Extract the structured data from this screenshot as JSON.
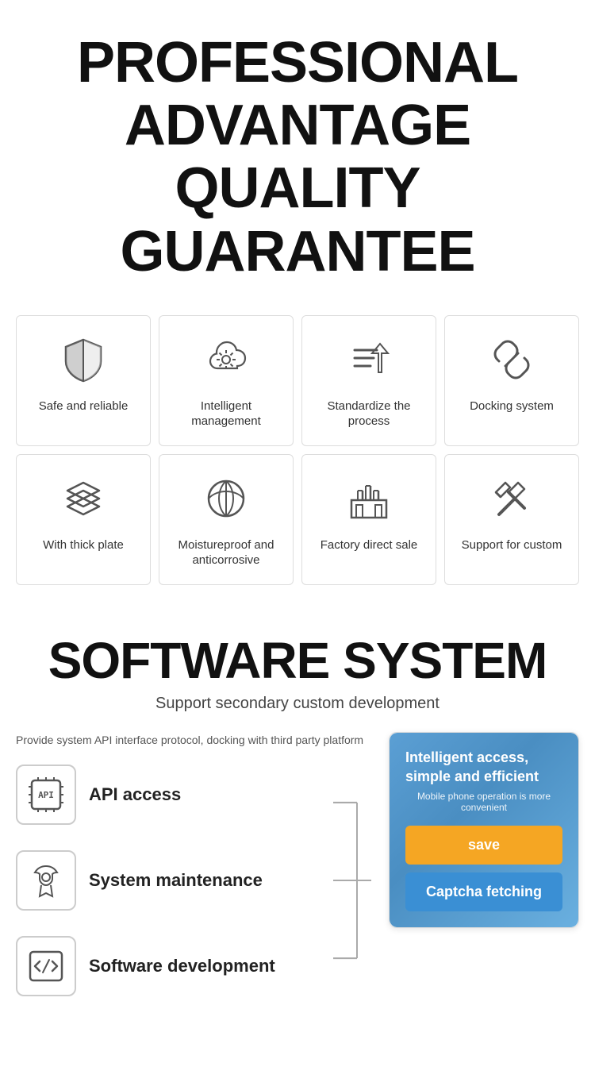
{
  "header": {
    "line1": "PROFESSIONAL",
    "line2": "ADVANTAGE",
    "line3": "QUALITY GUARANTEE"
  },
  "features_row1": [
    {
      "label": "Safe and reliable",
      "icon": "shield"
    },
    {
      "label": "Intelligent management",
      "icon": "cloud-settings"
    },
    {
      "label": "Standardize the process",
      "icon": "process"
    },
    {
      "label": "Docking system",
      "icon": "link"
    }
  ],
  "features_row2": [
    {
      "label": "With thick plate",
      "icon": "layers"
    },
    {
      "label": "Moistureproof and anticorrosive",
      "icon": "leaf"
    },
    {
      "label": "Factory direct sale",
      "icon": "factory"
    },
    {
      "label": "Support for custom",
      "icon": "tools"
    }
  ],
  "software": {
    "title": "SOFTWARE SYSTEM",
    "subtitle": "Support secondary custom development",
    "desc": "Provide system API interface protocol, docking with third party platform",
    "items": [
      {
        "label": "API access",
        "icon": "api"
      },
      {
        "label": "System maintenance",
        "icon": "maintenance"
      },
      {
        "label": "Software development",
        "icon": "code"
      }
    ],
    "panel": {
      "title": "Intelligent access, simple and efficient",
      "subtitle": "Mobile phone operation is more convenient",
      "save_btn": "save",
      "captcha_btn": "Captcha fetching"
    }
  }
}
